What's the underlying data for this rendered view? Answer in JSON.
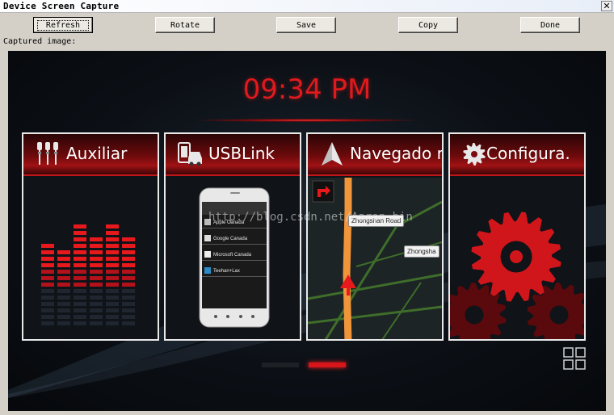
{
  "window": {
    "title": "Device Screen Capture",
    "close_label": "✕"
  },
  "toolbar": {
    "refresh_label": "Refresh",
    "rotate_label": "Rotate",
    "save_label": "Save",
    "copy_label": "Copy",
    "done_label": "Done"
  },
  "captured_label": "Captured image:",
  "screen": {
    "clock": "09:34 PM",
    "accent_color": "#e0191c",
    "watermark": "http://blog.csdn.net/Aaron_bin",
    "cards": [
      {
        "title": "Auxiliar",
        "icon": "audio-jacks-icon"
      },
      {
        "title": "USBLink",
        "icon": "phone-car-icon"
      },
      {
        "title": "Navegado r",
        "icon": "navigation-arrow-icon"
      },
      {
        "title": "Configura.",
        "icon": "gear-icon"
      }
    ],
    "phone_list": [
      "Apple Canada",
      "Google Canada",
      "Microsoft Canada",
      "Teehan+Lax"
    ],
    "map_labels": [
      "Zhongshan Road",
      "Zhongsha"
    ],
    "pager": {
      "pages": 2,
      "active_page": 2
    }
  }
}
